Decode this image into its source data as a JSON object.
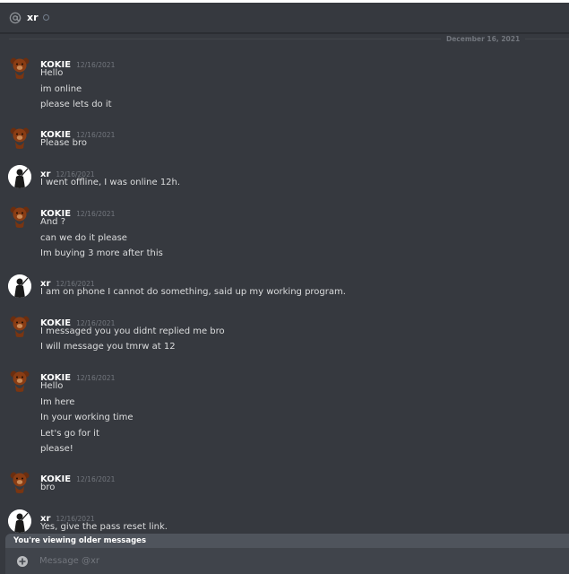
{
  "header": {
    "recipient": "xr"
  },
  "date_divider": "December 16, 2021",
  "messages": [
    {
      "author": "KOKIE",
      "avatar": "bear-avatar",
      "timestamp": "12/16/2021",
      "lines": [
        "Hello",
        "im online",
        "please lets do it"
      ]
    },
    {
      "author": "KOKIE",
      "avatar": "bear-avatar",
      "timestamp": "12/16/2021",
      "lines": [
        "Please bro"
      ]
    },
    {
      "author": "xr",
      "avatar": "xr-avatar",
      "timestamp": "12/16/2021",
      "lines": [
        "I went offline, I was online 12h."
      ]
    },
    {
      "author": "KOKIE",
      "avatar": "bear-avatar",
      "timestamp": "12/16/2021",
      "lines": [
        "And ?",
        "can we do it please",
        "Im buying 3 more after this"
      ]
    },
    {
      "author": "xr",
      "avatar": "xr-avatar",
      "timestamp": "12/16/2021",
      "lines": [
        "I am on phone I cannot do something, said up my working program."
      ]
    },
    {
      "author": "KOKIE",
      "avatar": "bear-avatar",
      "timestamp": "12/16/2021",
      "lines": [
        "I messaged you you didnt replied me bro",
        "I will message you tmrw at 12"
      ]
    },
    {
      "author": "KOKIE",
      "avatar": "bear-avatar",
      "timestamp": "12/16/2021",
      "lines": [
        "Hello",
        "Im here",
        "In your working time",
        "Let's go for it",
        "please!"
      ]
    },
    {
      "author": "KOKIE",
      "avatar": "bear-avatar",
      "timestamp": "12/16/2021",
      "lines": [
        "bro"
      ]
    },
    {
      "author": "xr",
      "avatar": "xr-avatar",
      "timestamp": "12/16/2021",
      "lines": [
        "Yes, give the pass reset link."
      ]
    }
  ],
  "older_messages_notice": "You're viewing older messages",
  "composer": {
    "placeholder": "Message @xr"
  },
  "colors": {
    "background": "#36393f",
    "text": "#dcddde",
    "muted": "#72767d",
    "notice_bar": "#4f545c",
    "composer": "#40444b"
  }
}
